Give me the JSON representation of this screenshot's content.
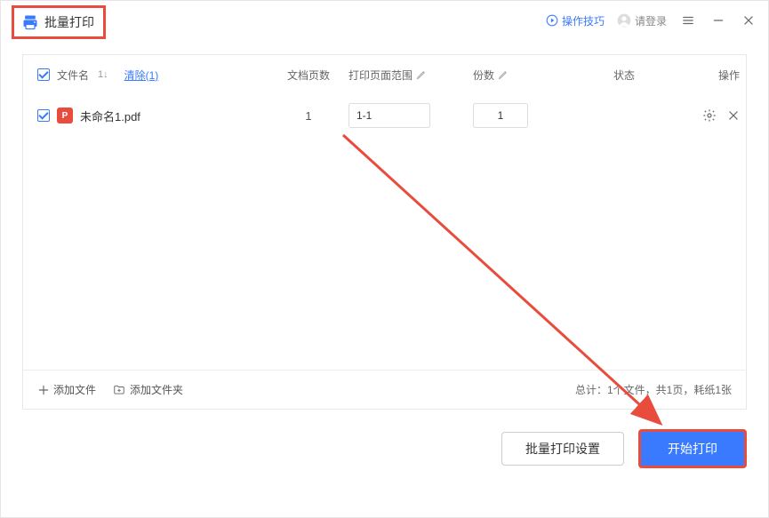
{
  "title": "批量打印",
  "tips_link": "操作技巧",
  "login_link": "请登录",
  "columns": {
    "filename": "文件名",
    "clear": "清除(1)",
    "pages": "文档页数",
    "range": "打印页面范围",
    "copies": "份数",
    "status": "状态",
    "action": "操作"
  },
  "row": {
    "filename": "未命名1.pdf",
    "pages": "1",
    "range": "1-1",
    "copies": "1"
  },
  "footer": {
    "add_file": "添加文件",
    "add_folder": "添加文件夹",
    "summary": "总计：1个文件，共1页，耗纸1张"
  },
  "buttons": {
    "settings": "批量打印设置",
    "start": "开始打印"
  }
}
